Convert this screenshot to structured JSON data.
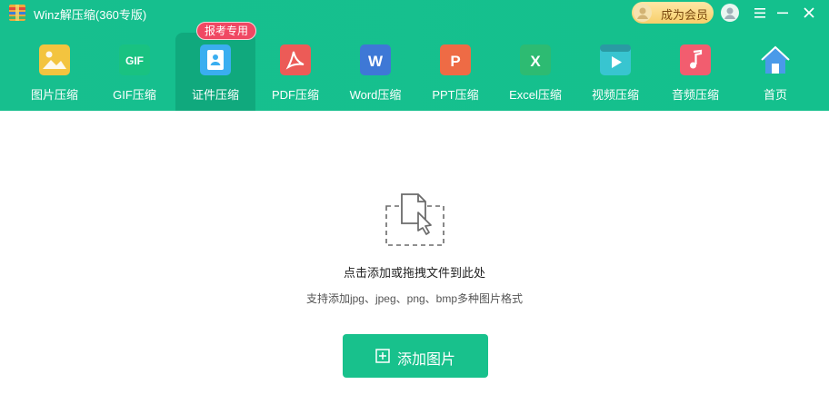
{
  "app": {
    "title": "Winz解压缩(360专版)"
  },
  "titlebar": {
    "vip_label": "成为会员",
    "icons": [
      "user-icon",
      "menu-icon",
      "minimize-icon",
      "close-icon"
    ]
  },
  "toolbar": {
    "badge": "报考专用",
    "tools": [
      {
        "label": "图片压缩",
        "icon": "image-icon",
        "color": "#f3c43f"
      },
      {
        "label": "GIF压缩",
        "icon": "gif-icon",
        "color": "#19c281",
        "icon_text": "GIF"
      },
      {
        "label": "证件压缩",
        "icon": "id-card-icon",
        "color": "#3aaef0",
        "active": true
      },
      {
        "label": "PDF压缩",
        "icon": "pdf-icon",
        "color": "#ec5b57"
      },
      {
        "label": "Word压缩",
        "icon": "word-icon",
        "color": "#3e78d6",
        "icon_text": "W"
      },
      {
        "label": "PPT压缩",
        "icon": "ppt-icon",
        "color": "#ee6b45",
        "icon_text": "P"
      },
      {
        "label": "Excel压缩",
        "icon": "excel-icon",
        "color": "#2dbb72",
        "icon_text": "X"
      },
      {
        "label": "视频压缩",
        "icon": "video-icon",
        "color": "#38c5d0"
      },
      {
        "label": "音频压缩",
        "icon": "audio-icon",
        "color": "#f25d6f"
      },
      {
        "label": "首页",
        "icon": "home-icon",
        "color": "#4a9ae9"
      }
    ]
  },
  "main": {
    "drop_title": "点击添加或拖拽文件到此处",
    "drop_subtitle": "支持添加jpg、jpeg、png、bmp多种图片格式",
    "add_button": "添加图片"
  },
  "colors": {
    "header_green": "#16bf8c",
    "button_green": "#18c18c",
    "badge_red": "#f04863",
    "vip_gold": "#f7cf6a"
  }
}
